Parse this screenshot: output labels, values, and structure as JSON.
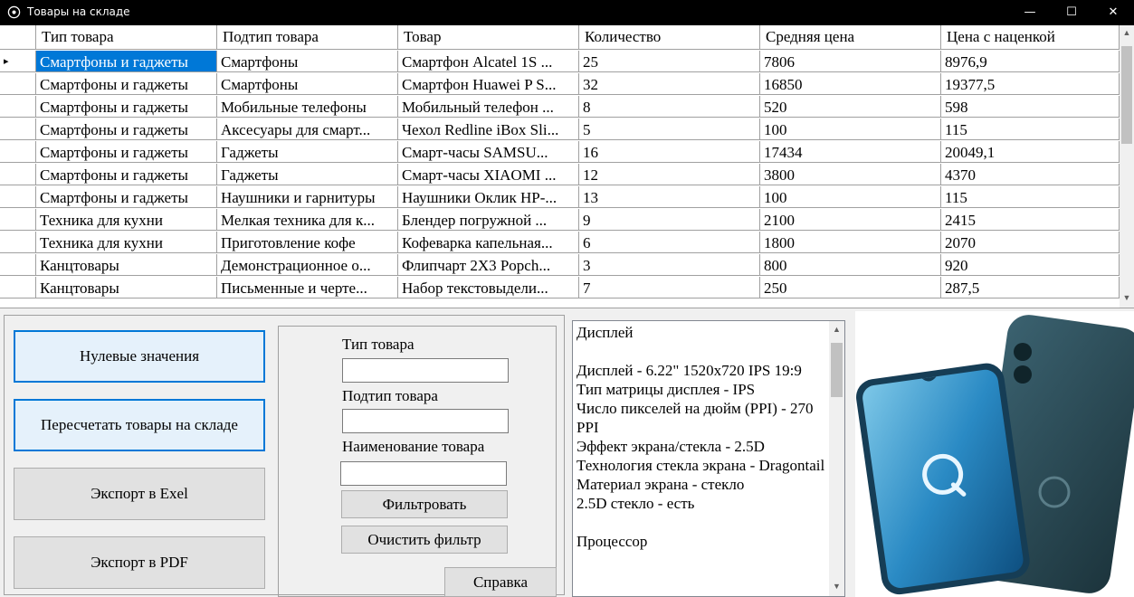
{
  "window": {
    "title": "Товары на складе",
    "minimize": "—",
    "maximize": "☐",
    "close": "✕"
  },
  "grid": {
    "columns": [
      "Тип товара",
      "Подтип товара",
      "Товар",
      "Количество",
      "Средняя цена",
      "Цена с наценкой"
    ],
    "rows": [
      [
        "Смартфоны и гаджеты",
        "Смартфоны",
        "Смартфон Alcatel 1S ...",
        "25",
        "7806",
        "8976,9"
      ],
      [
        "Смартфоны и гаджеты",
        "Смартфоны",
        "Смартфон Huawei P S...",
        "32",
        "16850",
        "19377,5"
      ],
      [
        "Смартфоны и гаджеты",
        "Мобильные телефоны",
        "Мобильный телефон ...",
        "8",
        "520",
        "598"
      ],
      [
        "Смартфоны и гаджеты",
        "Аксесуары для смарт...",
        "Чехол Redline iBox Sli...",
        "5",
        "100",
        "115"
      ],
      [
        "Смартфоны и гаджеты",
        "Гаджеты",
        "Смарт-часы SAMSU...",
        "16",
        "17434",
        "20049,1"
      ],
      [
        "Смартфоны и гаджеты",
        "Гаджеты",
        "Смарт-часы XIAOMI ...",
        "12",
        "3800",
        "4370"
      ],
      [
        "Смартфоны и гаджеты",
        "Наушники и гарнитуры",
        "Наушники Оклик HP-...",
        "13",
        "100",
        "115"
      ],
      [
        "Техника для кухни",
        "Мелкая техника для к...",
        "Блендер погружной ...",
        "9",
        "2100",
        "2415"
      ],
      [
        "Техника для кухни",
        "Приготовление кофе",
        "Кофеварка капельная...",
        "6",
        "1800",
        "2070"
      ],
      [
        "Канцтовары",
        "Демонстрационное о...",
        "Флипчарт 2X3 Popch...",
        "3",
        "800",
        "920"
      ],
      [
        "Канцтовары",
        "Письменные и черте...",
        "Набор текстовыдели...",
        "7",
        "250",
        "287,5"
      ]
    ],
    "selected_row": 0,
    "current_row_marker": "▸"
  },
  "actions": {
    "zero_values": "Нулевые значения",
    "recount": "Пересчетать товары на складе",
    "export_excel": "Экспорт в Exel",
    "export_pdf": "Экспорт в PDF"
  },
  "filter": {
    "type_label": "Тип товара",
    "type_value": "",
    "subtype_label": "Подтип товара",
    "subtype_value": "",
    "name_label": "Наименование товара",
    "name_value": "",
    "filter_button": "Фильтровать",
    "clear_button": "Очистить фильтр",
    "help_button": "Справка"
  },
  "description": {
    "text": "Дисплей\n\nДисплей - 6.22\" 1520x720 IPS 19:9\nТип матрицы дисплея - IPS\nЧисло пикселей на дюйм (PPI) - 270 PPI\nЭффект экрана/стекла - 2.5D\nТехнология стекла экрана - Dragontail\nМатериал экрана - стекло\n2.5D стекло - есть\n\nПроцессор"
  },
  "image": {
    "alt": "Фото товара: смартфон"
  },
  "colors": {
    "selection": "#0078d7",
    "titlebar": "#000000",
    "phone_body": "#2c4b55"
  }
}
